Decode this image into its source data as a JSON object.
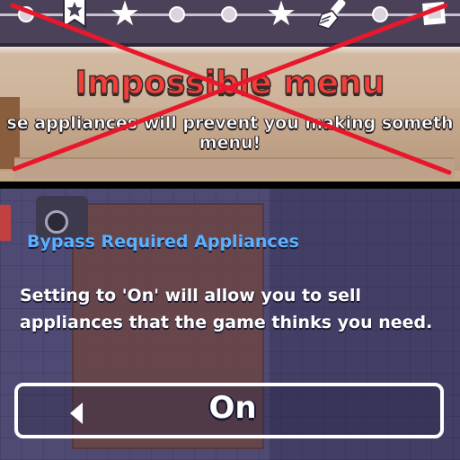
{
  "top_panel": {
    "title": "Impossible menu",
    "description_line1": "se appliances will prevent you making someth",
    "description_line2": "menu!",
    "cross_color": "#e8182c",
    "progress_track": {
      "icons": [
        "dot-icon",
        "bookmark-star-icon",
        "star-icon",
        "dot-icon",
        "dot-icon",
        "star-icon",
        "brush-icon",
        "dot-icon",
        "tile-icon"
      ]
    }
  },
  "setting": {
    "title": "Bypass Required Appliances",
    "description": "Setting to 'On' will allow you to sell appliances that the game thinks you need.",
    "value": "On",
    "title_color": "#5ab1ff"
  }
}
